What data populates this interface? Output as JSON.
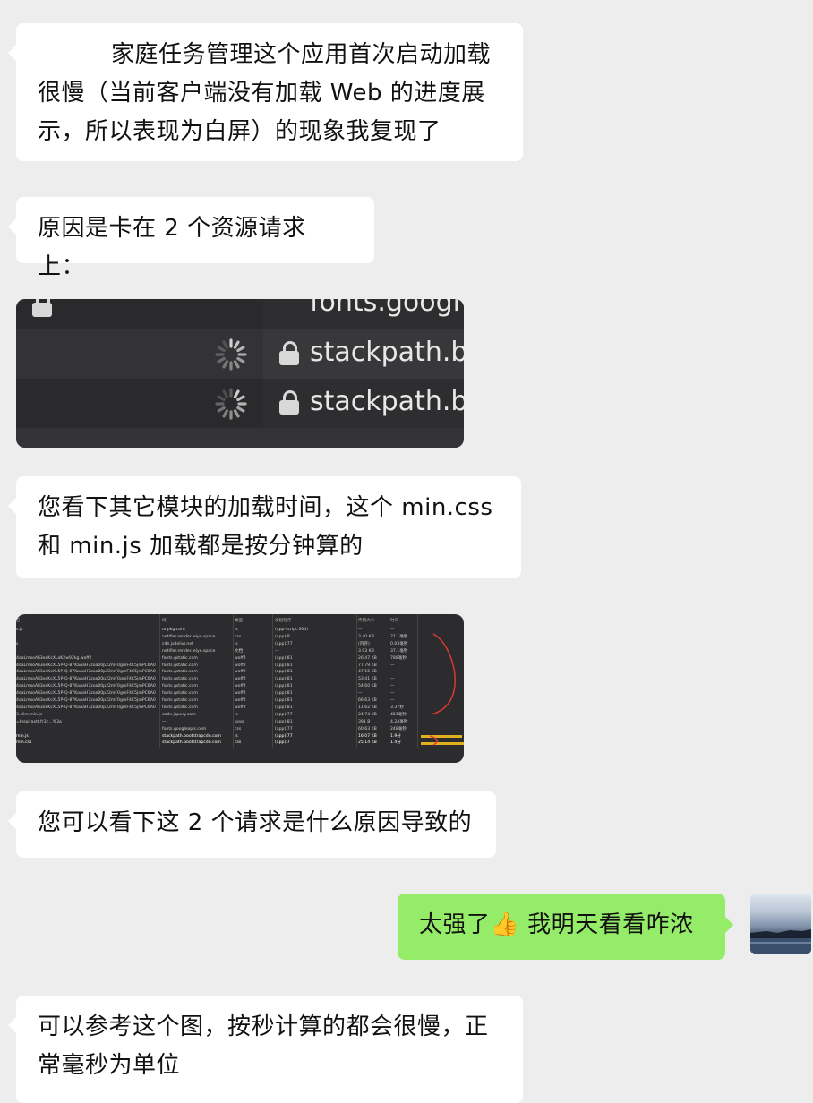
{
  "messages": {
    "m1": {
      "text_line1": "家庭任务管理这个应用首次启动加载",
      "text_line2": "很慢（当前客户端没有加载 Web 的进度展",
      "text_line3": "示，所以表现为白屏）的现象我复现了"
    },
    "m2": {
      "text": "原因是卡在 2 个资源请求上："
    },
    "m3": {
      "text_line1": "您看下其它模块的加载时间，这个 min.css",
      "text_line2": "和 min.js 加载都是按分钟算的"
    },
    "m4": {
      "text": "您可以看下这 2 个请求是什么原因导致的"
    },
    "m5": {
      "text_before": "太强了",
      "emoji": "👍",
      "text_after": " 我明天看看咋浓"
    },
    "m6": {
      "text_line1": "可以参考这个图，按秒计算的都会很慢，正",
      "text_line2": "常毫秒为单位"
    }
  },
  "image1": {
    "hosts": [
      "fonts.googl",
      "stackpath.b",
      "stackpath.b"
    ]
  },
  "image2": {
    "headers": {
      "name": "名",
      "domain": "域",
      "type": "类型",
      "initiator": "发起程序",
      "size": "传输大小",
      "time": "时间"
    },
    "rows": [
      {
        "name": "s.js",
        "domain": "unpkg.com",
        "type": "js",
        "initiator": "(app-script:304)",
        "size": "—",
        "time": "—"
      },
      {
        "name": "",
        "domain": "netifier.render.leiyo.space",
        "type": "css",
        "initiator": "(app):8",
        "size": "3.40 KB",
        "time": "21.1毫秒"
      },
      {
        "name": "s",
        "domain": "cdn.jsdelivr.net",
        "type": "js",
        "initiator": "(app):77",
        "size": "(内存)",
        "time": "0.03毫秒"
      },
      {
        "name": "",
        "domain": "netifier.render.leiyo.space",
        "type": "文档",
        "initiator": "—",
        "size": "3.93 KB",
        "time": "37.1毫秒"
      },
      {
        "name": "4oaLmxoAIi3oeKcXLoK2w92kg.woff2",
        "domain": "fonts.gstatic.com",
        "type": "woff2",
        "initiator": "(app):81",
        "size": "26.47 KB",
        "time": "788毫秒"
      },
      {
        "name": "4oaLmxoAIi3oeKcXL5P-Q-87KaAaH7zoa00p22mF0gmF4C5jmPC6A0R…",
        "domain": "fonts.gstatic.com",
        "type": "woff2",
        "initiator": "(app):81",
        "size": "77.79 KB",
        "time": "—"
      },
      {
        "name": "4oaLmxoAIi3oeKcXL5P-Q-87KaAaH7zoa00p22mF0gmF4C5jmPC6A0R…",
        "domain": "fonts.gstatic.com",
        "type": "woff2",
        "initiator": "(app):81",
        "size": "47.15 KB",
        "time": "—"
      },
      {
        "name": "4oaLmxoAIi3oeKcXL5P-Q-87KaAaH7zoa00p22mF0gmF4C5jmPC6A0R…",
        "domain": "fonts.gstatic.com",
        "type": "woff2",
        "initiator": "(app):81",
        "size": "53.41 KB",
        "time": "—"
      },
      {
        "name": "4oaLmxoAIi3oeKcXL5P-Q-87KaAaH7zoa00p22mF0gmF4C5jmPC6A0R…",
        "domain": "fonts.gstatic.com",
        "type": "woff2",
        "initiator": "(app):81",
        "size": "54.60 KB",
        "time": "—"
      },
      {
        "name": "4oaLmxoAIi3oeKcXL5P-Q-87KaAaH7zoa00p22mF0gmF4C5jmPC6A0R…",
        "domain": "fonts.gstatic.com",
        "type": "woff2",
        "initiator": "(app):81",
        "size": "—",
        "time": "—"
      },
      {
        "name": "4oaLmxoAIi3oeKcXL5P-Q-87KaAaH7zoa00p22mF0gmF4C5jmPC6A0R…",
        "domain": "fonts.gstatic.com",
        "type": "woff2",
        "initiator": "(app):81",
        "size": "66.63 KB",
        "time": "—"
      },
      {
        "name": "4oaLmxoAIi3oeKcXL5P-Q-87KaAaH7zoa00p22mF0gmF4C5jmPC6A0Rg5g…",
        "domain": "fonts.gstatic.com",
        "type": "woff2",
        "initiator": "(app):81",
        "size": "11.62 KB",
        "time": "3.37秒"
      },
      {
        "name": "3.slim.min.js",
        "domain": "code.jquery.com",
        "type": "js",
        "initiator": "(app):77",
        "size": "24.74 KB",
        "time": "451毫秒"
      },
      {
        "name": "=Inspiraxtt,fr3c…%3a",
        "domain": "—",
        "type": "jpeg",
        "initiator": "(app):81",
        "size": "391 B",
        "time": "4.24毫秒"
      },
      {
        "name": "",
        "domain": "fonts.googleapis.com",
        "type": "css",
        "initiator": "(app):77",
        "size": "60.63 KB",
        "time": "248毫秒"
      },
      {
        "name": "min.js",
        "domain": "stackpath.bootstrapcdn.com",
        "type": "js",
        "initiator": "(app):77",
        "size": "16.07 KB",
        "time": "1.9分"
      },
      {
        "name": "min.css",
        "domain": "stackpath.bootstrapcdn.com",
        "type": "css",
        "initiator": "(app):7",
        "size": "25.14 KB",
        "time": "1.4分"
      }
    ]
  },
  "avatar": {
    "alt": "avatar"
  }
}
